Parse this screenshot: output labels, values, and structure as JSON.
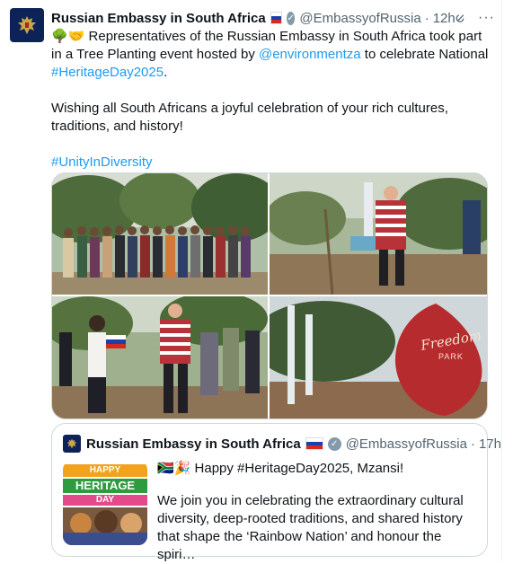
{
  "tweet": {
    "author_name": "Russian Embassy in South Africa",
    "handle": "@EmbassyofRussia",
    "separator": "·",
    "time": "12h",
    "more_label": "···",
    "text": {
      "emoji": "🌳🤝",
      "line1": " Representatives of the Russian Embassy in South Africa took part in a Tree Planting event hosted by ",
      "mention": "@environmentza",
      "line1_tail": " to celebrate National ",
      "hashtag1": "#HeritageDay2025",
      "line1_end": ".",
      "para2": "Wishing all South Africans a joyful celebration of your rich cultures, traditions, and history!",
      "hashtag2": "#UnityInDiversity"
    },
    "media": {
      "photo4_sign_title": "Freedom",
      "photo4_sign_sub": "PARK"
    }
  },
  "quote": {
    "author_name": "Russian Embassy in South Africa",
    "handle": "@EmbassyofRussia",
    "separator": "·",
    "time": "17h",
    "thumb_word1": "HAPPY",
    "thumb_word2": "HERITAGE",
    "thumb_word3": "DAY",
    "line1_emoji": "🇿🇦🎉",
    "line1": " Happy #HeritageDay2025, Mzansi!",
    "para2": "We join you in celebrating the extraordinary cultural diversity, deep-rooted traditions, and shared history that shape the ‘Rainbow Nation’ and honour the spiri…"
  },
  "colors": {
    "link": "#1d9bf0",
    "muted": "#536471",
    "border": "#cfd9de",
    "avatar_bg": "#0d2358"
  }
}
